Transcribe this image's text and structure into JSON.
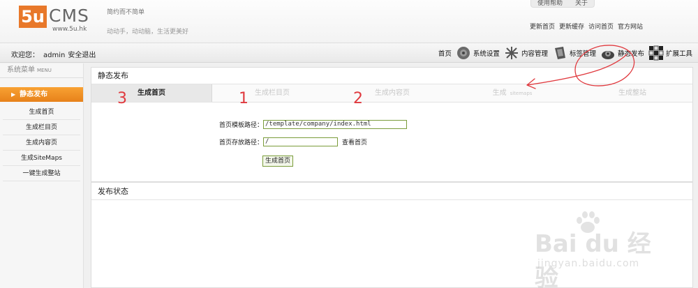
{
  "header": {
    "logo_5u": "5u",
    "logo_cms": "CMS",
    "logo_url": "www.5u.hk",
    "slogan_top": "简约而不简单",
    "slogan_bottom": "动动手，动动脑，生活更美好",
    "top_links": [
      "使用帮助",
      "关于"
    ],
    "quick_links": [
      "更新首页",
      "更新缓存",
      "访问首页",
      "官方网站"
    ]
  },
  "navbar": {
    "welcome_label": "欢迎您：",
    "username": "admin",
    "logout": "安全退出",
    "items": [
      {
        "label": "首页",
        "icon": "none"
      },
      {
        "label": "系统设置",
        "icon": "system-settings-icon"
      },
      {
        "label": "内容管理",
        "icon": "content-management-icon"
      },
      {
        "label": "标签管理",
        "icon": "tag-management-icon"
      },
      {
        "label": "静态发布",
        "icon": "static-publish-icon"
      },
      {
        "label": "扩展工具",
        "icon": "extension-tools-icon"
      }
    ]
  },
  "sidebar": {
    "title": "系统菜单",
    "title_en": "MENU",
    "active": "静态发布",
    "items": [
      "生成首页",
      "生成栏目页",
      "生成内容页",
      "生成SiteMaps",
      "一键生成整站"
    ]
  },
  "panel": {
    "title": "静态发布",
    "tabs": [
      {
        "label": "生成首页",
        "extra": "",
        "active": true
      },
      {
        "label": "生成栏目页",
        "extra": "",
        "active": false
      },
      {
        "label": "生成内容页",
        "extra": "",
        "active": false
      },
      {
        "label": "生成",
        "extra": "sitemaps",
        "active": false
      },
      {
        "label": "生成整站",
        "extra": "",
        "active": false
      }
    ],
    "template_label": "首页模板路径：",
    "template_value": "/template/company/index.html",
    "save_label": "首页存放路径：",
    "save_value": "/",
    "view_link": "查看首页",
    "generate_button": "生成首页"
  },
  "status": {
    "title": "发布状态"
  },
  "annotations": {
    "numbers": [
      "3",
      "1",
      "2"
    ],
    "color": "#e0393e"
  },
  "watermark": {
    "main": "Bai du 经验",
    "sub": "jingyan.baidu.com"
  },
  "colors": {
    "accent_orange": "#e8821b",
    "field_border": "#7a9c3a"
  }
}
